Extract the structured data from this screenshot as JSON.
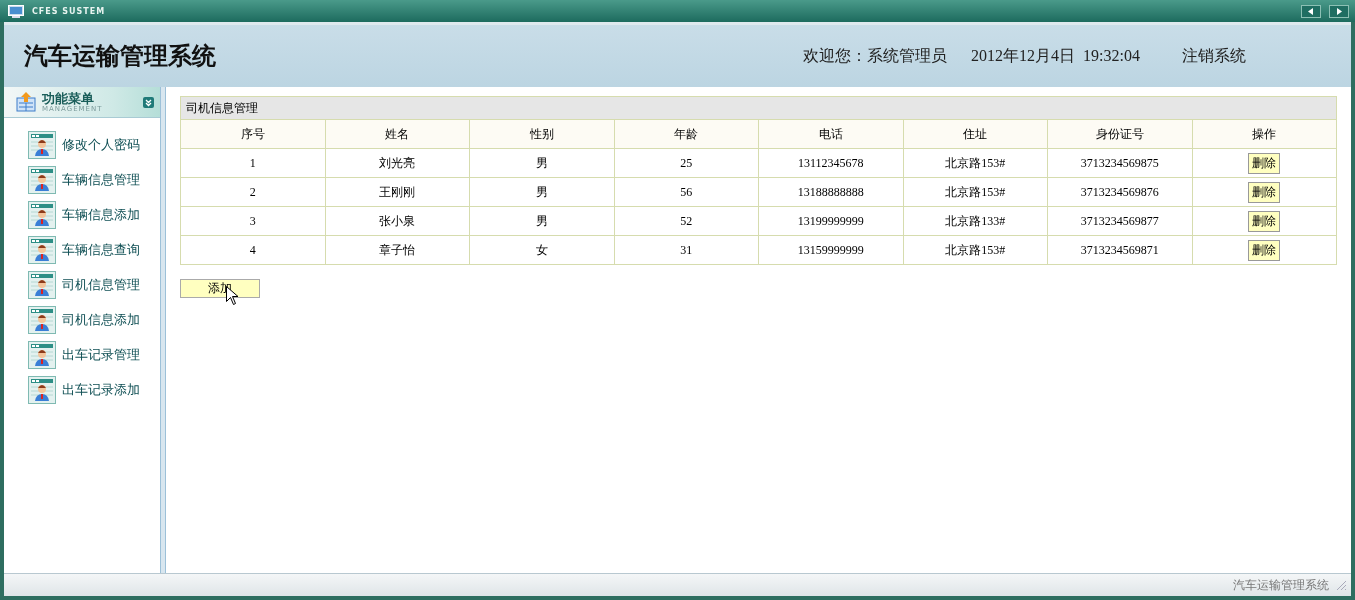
{
  "window": {
    "title": "CFES SUSTEM"
  },
  "header": {
    "title": "汽车运输管理系统",
    "welcome": "欢迎您：系统管理员",
    "datetime": "2012年12月4日  19:32:04",
    "logout": "注销系统"
  },
  "sidebar": {
    "title": "功能菜单",
    "subtitle": "MANAGEMENT",
    "items": [
      {
        "label": "修改个人密码"
      },
      {
        "label": "车辆信息管理"
      },
      {
        "label": "车辆信息添加"
      },
      {
        "label": "车辆信息查询"
      },
      {
        "label": "司机信息管理"
      },
      {
        "label": "司机信息添加"
      },
      {
        "label": "出车记录管理"
      },
      {
        "label": "出车记录添加"
      }
    ]
  },
  "panel": {
    "title": "司机信息管理",
    "columns": [
      "序号",
      "姓名",
      "性别",
      "年龄",
      "电话",
      "住址",
      "身份证号",
      "操作"
    ],
    "rows": [
      {
        "cells": [
          "1",
          "刘光亮",
          "男",
          "25",
          "13112345678",
          "北京路153#",
          "3713234569875"
        ],
        "action": "删除"
      },
      {
        "cells": [
          "2",
          "王刚刚",
          "男",
          "56",
          "13188888888",
          "北京路153#",
          "3713234569876"
        ],
        "action": "删除"
      },
      {
        "cells": [
          "3",
          "张小泉",
          "男",
          "52",
          "13199999999",
          "北京路133#",
          "3713234569877"
        ],
        "action": "删除"
      },
      {
        "cells": [
          "4",
          "章子怡",
          "女",
          "31",
          "13159999999",
          "北京路153#",
          "3713234569871"
        ],
        "action": "删除"
      }
    ],
    "add_button": "添加"
  },
  "status_bar": {
    "text": "汽车运输管理系统"
  }
}
